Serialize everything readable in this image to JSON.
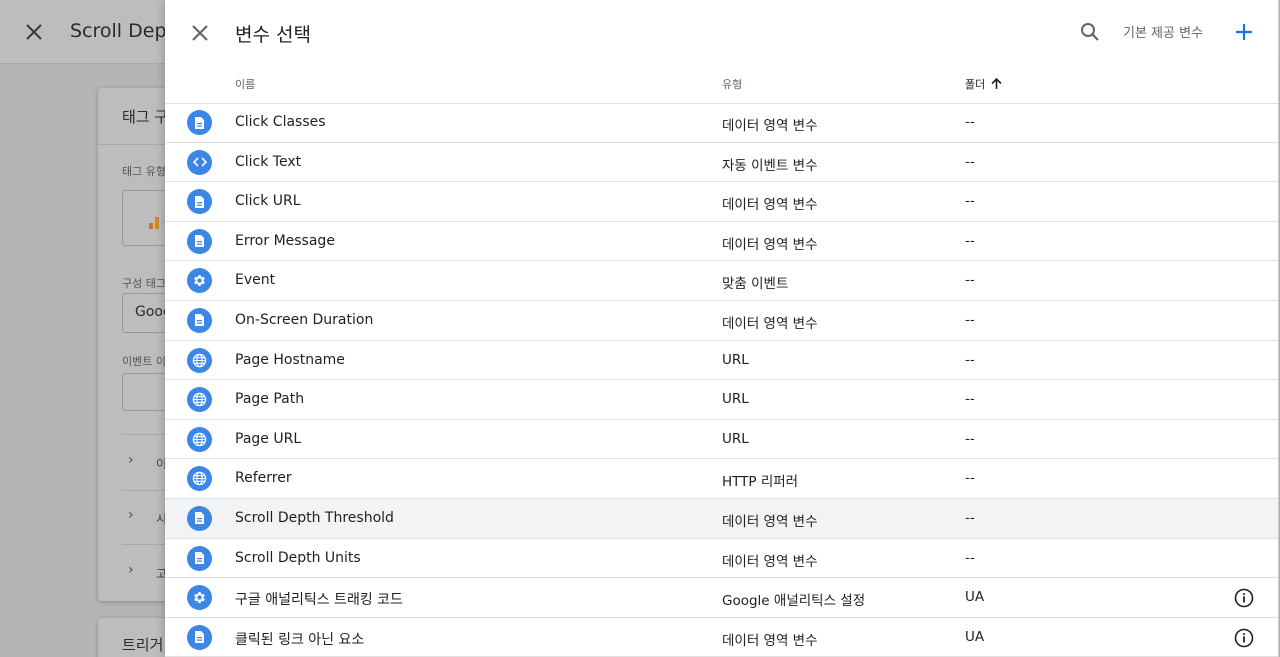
{
  "background": {
    "title": "Scroll Dept",
    "card_title": "태그 구",
    "tag_type_label": "태그 유형",
    "config_label": "구성 태그",
    "config_value": "Goog",
    "event_label": "이벤트 이",
    "chevron_rows": [
      "이",
      "시",
      "고"
    ],
    "trigger_card_title": "트리거"
  },
  "panel": {
    "title": "변수 선택",
    "builtin_label": "기본 제공 변수",
    "accent_color": "#1a73e8",
    "icon_color": "#3c86e6",
    "columns": {
      "name": "이름",
      "type": "유형",
      "folder": "폴더"
    },
    "rows": [
      {
        "icon": "document-icon",
        "name": "Click Classes",
        "type": "데이터 영역 변수",
        "folder": "--",
        "info": false
      },
      {
        "icon": "code-icon",
        "name": "Click Text",
        "type": "자동 이벤트 변수",
        "folder": "--",
        "info": false
      },
      {
        "icon": "document-icon",
        "name": "Click URL",
        "type": "데이터 영역 변수",
        "folder": "--",
        "info": false
      },
      {
        "icon": "document-icon",
        "name": "Error Message",
        "type": "데이터 영역 변수",
        "folder": "--",
        "info": false
      },
      {
        "icon": "gear-icon",
        "name": "Event",
        "type": "맞춤 이벤트",
        "folder": "--",
        "info": false
      },
      {
        "icon": "document-icon",
        "name": "On-Screen Duration",
        "type": "데이터 영역 변수",
        "folder": "--",
        "info": false
      },
      {
        "icon": "globe-icon",
        "name": "Page Hostname",
        "type": "URL",
        "folder": "--",
        "info": false
      },
      {
        "icon": "globe-icon",
        "name": "Page Path",
        "type": "URL",
        "folder": "--",
        "info": false
      },
      {
        "icon": "globe-icon",
        "name": "Page URL",
        "type": "URL",
        "folder": "--",
        "info": false
      },
      {
        "icon": "globe-icon",
        "name": "Referrer",
        "type": "HTTP 리퍼러",
        "folder": "--",
        "info": false
      },
      {
        "icon": "document-icon",
        "name": "Scroll Depth Threshold",
        "type": "데이터 영역 변수",
        "folder": "--",
        "info": false,
        "highlight": true
      },
      {
        "icon": "document-icon",
        "name": "Scroll Depth Units",
        "type": "데이터 영역 변수",
        "folder": "--",
        "info": false
      },
      {
        "icon": "gear-icon",
        "name": "구글 애널리틱스 트래킹 코드",
        "type": "Google 애널리틱스 설정",
        "folder": "UA",
        "info": true
      },
      {
        "icon": "document-icon",
        "name": "클릭된 링크 아닌 요소",
        "type": "데이터 영역 변수",
        "folder": "UA",
        "info": true
      }
    ]
  }
}
